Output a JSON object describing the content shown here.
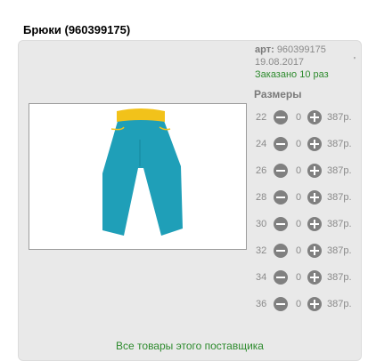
{
  "product": {
    "title": "Брюки (960399175)",
    "art_label": "арт:",
    "art_value": "960399175",
    "date": "19.08.2017",
    "ordered": "Заказано 10 раз",
    "tick": "'"
  },
  "sizes": {
    "title": "Размеры",
    "rows": [
      {
        "size": "22",
        "qty": "0",
        "price": "387р."
      },
      {
        "size": "24",
        "qty": "0",
        "price": "387р."
      },
      {
        "size": "26",
        "qty": "0",
        "price": "387р."
      },
      {
        "size": "28",
        "qty": "0",
        "price": "387р."
      },
      {
        "size": "30",
        "qty": "0",
        "price": "387р."
      },
      {
        "size": "32",
        "qty": "0",
        "price": "387р."
      },
      {
        "size": "34",
        "qty": "0",
        "price": "387р."
      },
      {
        "size": "36",
        "qty": "0",
        "price": "387р."
      }
    ]
  },
  "footer": {
    "link_text": "Все товары этого поставщика"
  },
  "colors": {
    "pants": "#1f9fb8",
    "waistband": "#f2c21a",
    "link": "#2e8b2e"
  }
}
